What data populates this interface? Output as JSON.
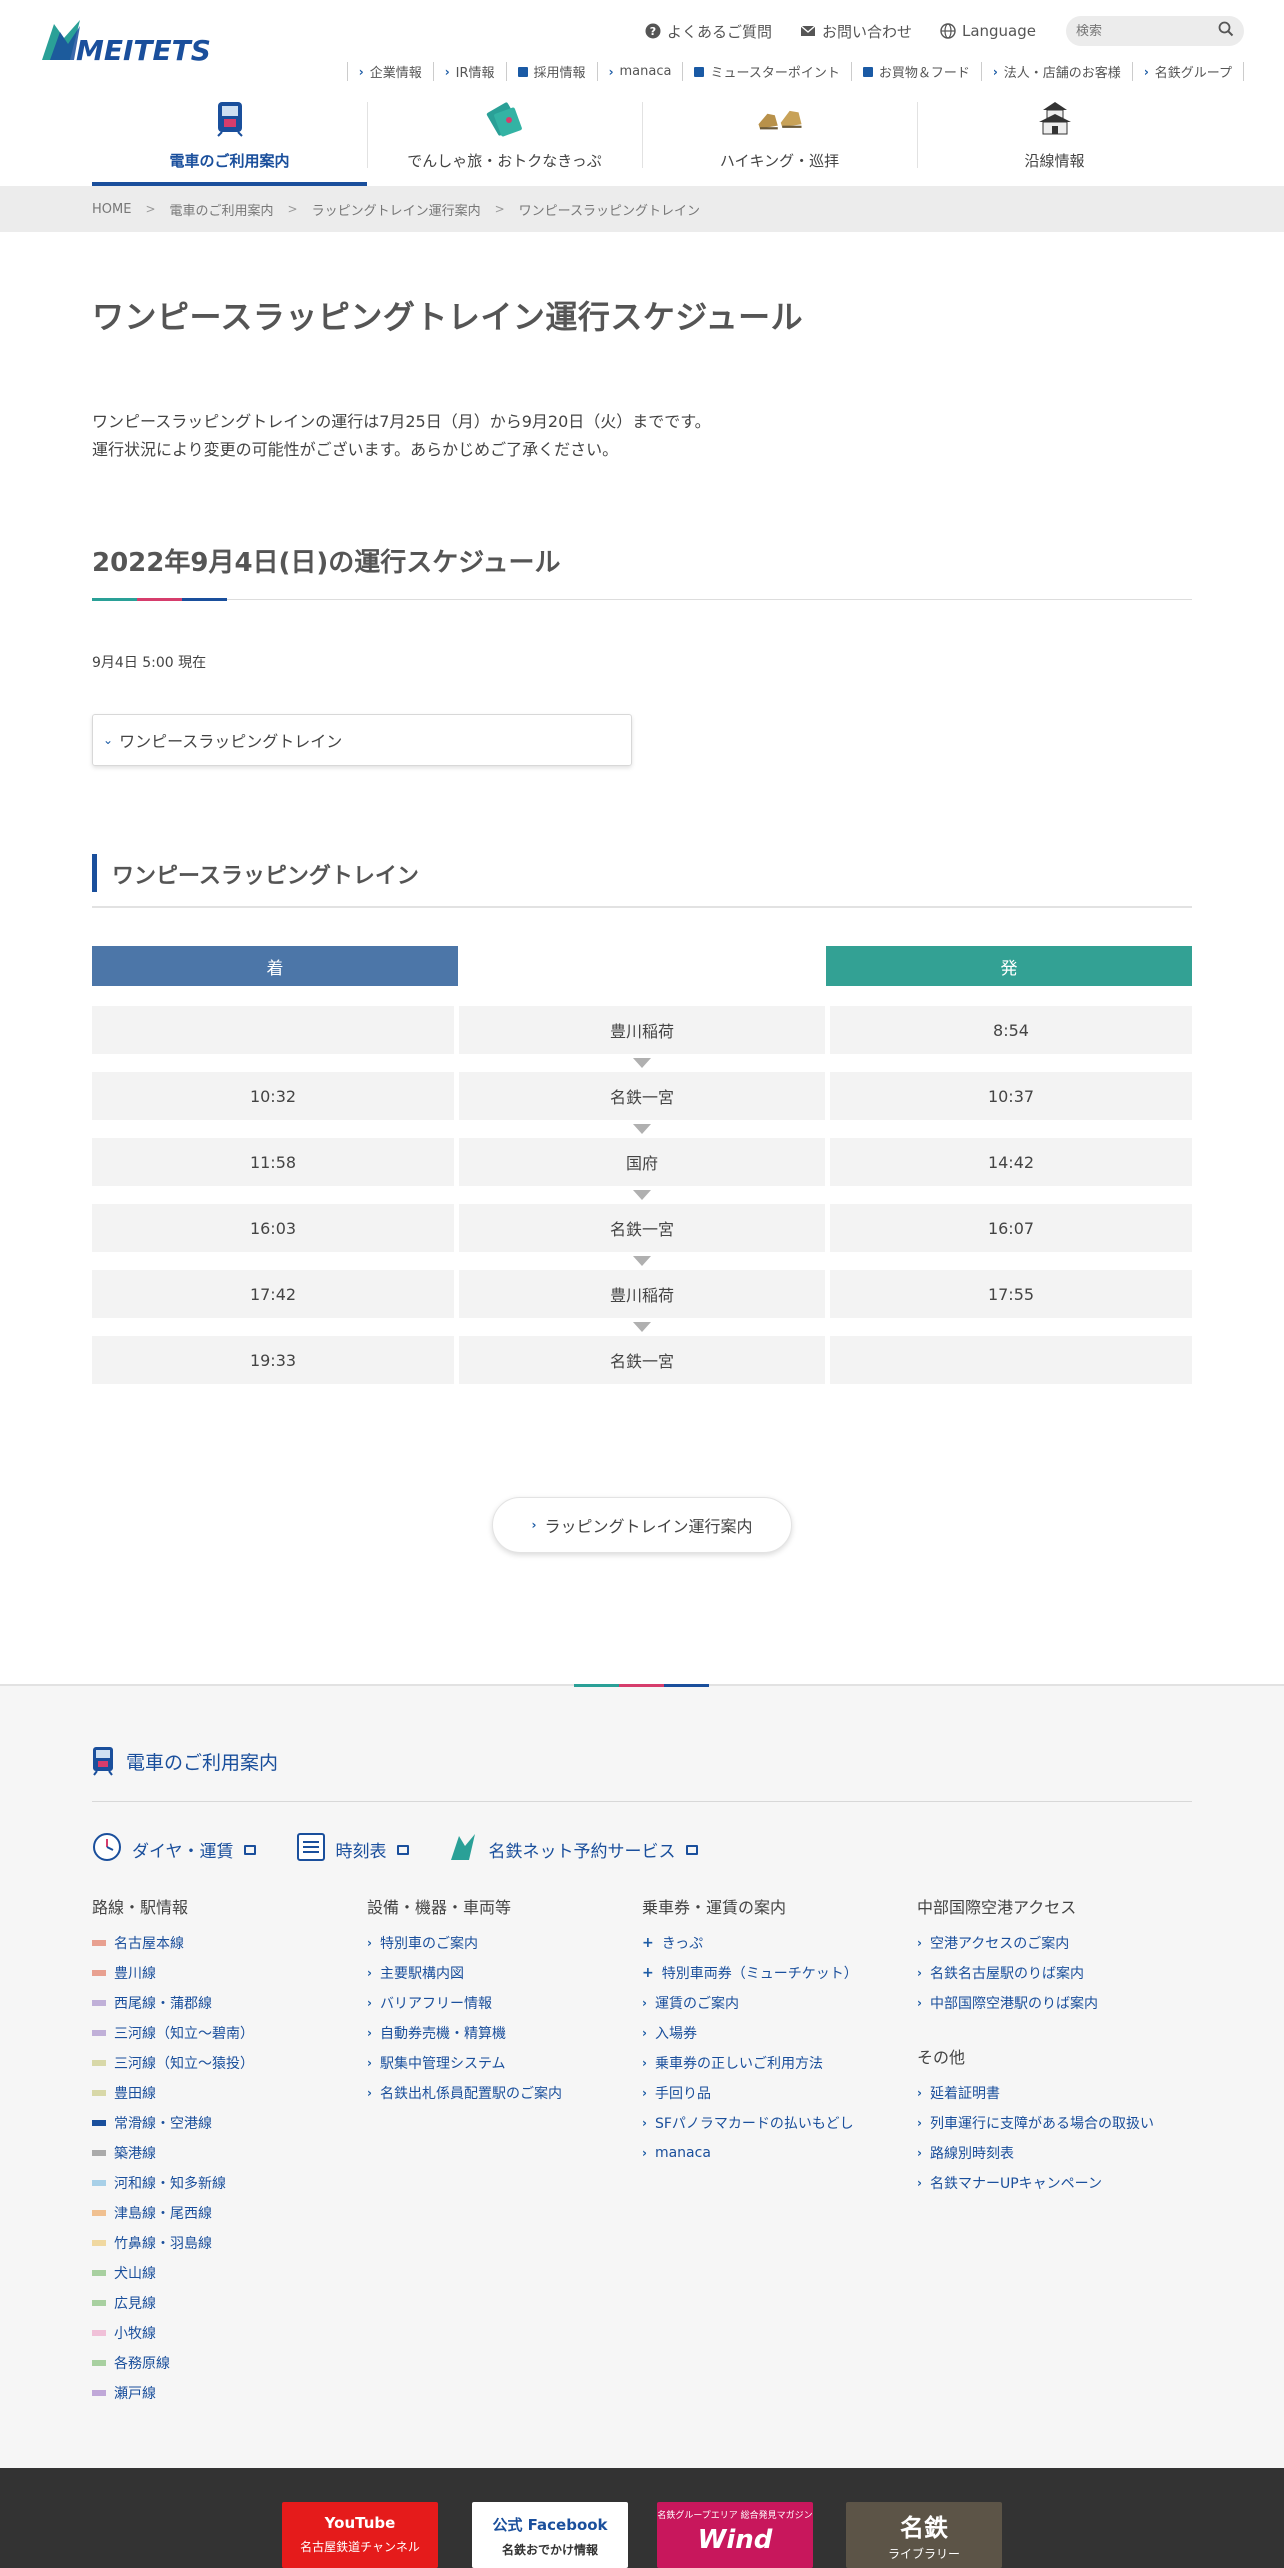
{
  "header": {
    "logo_text": "MEITETSU",
    "util": [
      {
        "label": "よくあるご質問",
        "icon": "question-circle-icon"
      },
      {
        "label": "お問い合わせ",
        "icon": "envelope-icon"
      },
      {
        "label": "Language",
        "icon": "globe-icon"
      }
    ],
    "search_placeholder": "検索",
    "subnav": [
      "企業情報",
      "IR情報",
      "採用情報",
      "manaca",
      "ミュースターポイント",
      "お買物＆フード",
      "法人・店舗のお客様",
      "名鉄グループ"
    ],
    "mainnav": [
      {
        "label": "電車のご利用案内",
        "icon": "train-icon",
        "active": true
      },
      {
        "label": "でんしゃ旅・おトクなきっぷ",
        "icon": "ticket-icon",
        "active": false
      },
      {
        "label": "ハイキング・巡拝",
        "icon": "boots-icon",
        "active": false
      },
      {
        "label": "沿線情報",
        "icon": "castle-icon",
        "active": false
      }
    ]
  },
  "breadcrumb": [
    "HOME",
    "電車のご利用案内",
    "ラッピングトレイン運行案内",
    "ワンピースラッピングトレイン"
  ],
  "main": {
    "title": "ワンピースラッピングトレイン運行スケジュール",
    "lead_lines": [
      "ワンピースラッピングトレインの運行は7月25日（月）から9月20日（火）までです。",
      "運行状況により変更の可能性がございます。あらかじめご了承ください。"
    ],
    "schedule_title": "2022年9月4日(日)の運行スケジュール",
    "as_of": "9月4日 5:00 現在",
    "toggle_label": "ワンピースラッピングトレイン",
    "train_title": "ワンピースラッピングトレイン",
    "col_arrive": "着",
    "col_depart": "発",
    "rows": [
      {
        "arrive": "",
        "station": "豊川稲荷",
        "depart": "8:54"
      },
      {
        "arrive": "10:32",
        "station": "名鉄一宮",
        "depart": "10:37"
      },
      {
        "arrive": "11:58",
        "station": "国府",
        "depart": "14:42"
      },
      {
        "arrive": "16:03",
        "station": "名鉄一宮",
        "depart": "16:07"
      },
      {
        "arrive": "17:42",
        "station": "豊川稲荷",
        "depart": "17:55"
      },
      {
        "arrive": "19:33",
        "station": "名鉄一宮",
        "depart": ""
      }
    ],
    "back_button": "ラッピングトレイン運行案内"
  },
  "footer": {
    "title": "電車のご利用案内",
    "links": [
      "ダイヤ・運賃",
      "時刻表",
      "名鉄ネット予約サービス"
    ],
    "col1_title": "路線・駅情報",
    "lines": [
      {
        "name": "名古屋本線",
        "color": "#e8a090"
      },
      {
        "name": "豊川線",
        "color": "#e8a090"
      },
      {
        "name": "西尾線・蒲郡線",
        "color": "#c0b0d8"
      },
      {
        "name": "三河線（知立〜碧南）",
        "color": "#c0b0d8"
      },
      {
        "name": "三河線（知立〜猿投）",
        "color": "#d8d8a8"
      },
      {
        "name": "豊田線",
        "color": "#d8d8a8"
      },
      {
        "name": "常滑線・空港線",
        "color": "#1a4f9c"
      },
      {
        "name": "築港線",
        "color": "#aaaaaa"
      },
      {
        "name": "河和線・知多新線",
        "color": "#a8d0e8"
      },
      {
        "name": "津島線・尾西線",
        "color": "#f0c090"
      },
      {
        "name": "竹鼻線・羽島線",
        "color": "#f0d8a0"
      },
      {
        "name": "犬山線",
        "color": "#a8d0a0"
      },
      {
        "name": "広見線",
        "color": "#a8d0a0"
      },
      {
        "name": "小牧線",
        "color": "#f0c0d8"
      },
      {
        "name": "各務原線",
        "color": "#a8d0a0"
      },
      {
        "name": "瀬戸線",
        "color": "#c0a8d8"
      }
    ],
    "col2_title": "設備・機器・車両等",
    "col2": [
      "特別車のご案内",
      "主要駅構内図",
      "バリアフリー情報",
      "自動券売機・精算機",
      "駅集中管理システム",
      "名鉄出札係員配置駅のご案内"
    ],
    "col3_title": "乗車券・運賃の案内",
    "col3": [
      {
        "label": "きっぷ",
        "expand": true
      },
      {
        "label": "特別車両券（ミューチケット）",
        "expand": true
      },
      {
        "label": "運賃のご案内",
        "expand": false
      },
      {
        "label": "入場券",
        "expand": false
      },
      {
        "label": "乗車券の正しいご利用方法",
        "expand": false
      },
      {
        "label": "手回り品",
        "expand": false
      },
      {
        "label": "SFパノラマカードの払いもどし",
        "expand": false
      },
      {
        "label": "manaca",
        "expand": false
      }
    ],
    "col4_title": "中部国際空港アクセス",
    "col4": [
      "空港アクセスのご案内",
      "名鉄名古屋駅のりば案内",
      "中部国際空港駅のりば案内"
    ],
    "col4b_title": "その他",
    "col4b": [
      "延着証明書",
      "列車運行に支障がある場合の取扱い",
      "路線別時刻表",
      "名鉄マナーUPキャンペーン"
    ]
  },
  "banners": [
    {
      "t1": "YouTube",
      "t2": "名古屋鉄道チャンネル"
    },
    {
      "t1": "公式 Facebook",
      "t2": "名鉄おでかけ情報"
    },
    {
      "t1": "Wind",
      "t2": "名鉄グループエリア 総合発見マガジン"
    },
    {
      "t1": "名鉄",
      "t2": "ライブラリー"
    }
  ],
  "colors": {
    "brand": "#1a4f9c",
    "arrive": "#4c76a8",
    "depart": "#33a194",
    "accent_pink": "#d63d6c",
    "accent_teal": "#2aa097"
  }
}
